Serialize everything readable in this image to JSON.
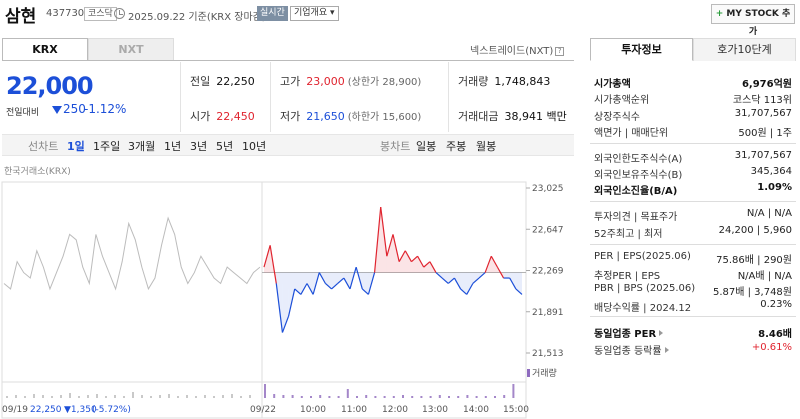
{
  "header": {
    "company_name": "삼현",
    "code": "437730",
    "market": "코스닥",
    "date_text": "2025.09.22 기준(KRX 장마감)",
    "realtime_label": "실시간",
    "overview_label": "기업개요 ▾",
    "mystock_label": "MY STOCK 추가",
    "mystock_plus": "+"
  },
  "tabs": {
    "krx": "KRX",
    "nxt": "NXT",
    "nxt_link": "넥스트레이드(NXT)",
    "help": "?"
  },
  "price": {
    "current": "22,000",
    "change_label": "전일대비",
    "change": "250",
    "change_pct": "-1.12%"
  },
  "stats": {
    "prev_label": "전일",
    "prev": "22,250",
    "high_label": "고가",
    "high": "23,000",
    "upper_limit": "(상한가 28,900)",
    "volume_label": "거래량",
    "volume": "1,748,843",
    "open_label": "시가",
    "open": "22,450",
    "low_label": "저가",
    "low": "21,650",
    "lower_limit": "(하한가 15,600)",
    "amount_label": "거래대금",
    "amount": "38,941 백만"
  },
  "period": {
    "line": "선차트",
    "d1": "1일",
    "w1": "1주일",
    "m3": "3개월",
    "y1": "1년",
    "y3": "3년",
    "y5": "5년",
    "y10": "10년",
    "candle": "봉차트",
    "daily": "일봉",
    "weekly": "주봉",
    "monthly": "월봉"
  },
  "chart_data": {
    "type": "line",
    "source_label": "한국거래소(KRX)",
    "volume_label": "거래량",
    "y_ticks": [
      "23,025",
      "22,647",
      "22,269",
      "21,891",
      "21,513"
    ],
    "ylim": [
      21513,
      23025
    ],
    "baseline": 22250,
    "x_ticks": [
      "09/22",
      "10:00",
      "11:00",
      "12:00",
      "13:00",
      "14:00",
      "15:00"
    ],
    "prev_day": {
      "label": "09/19",
      "close": "22,250",
      "change": "▼1,350",
      "pct": "(-5.72%)"
    },
    "previous_series": [
      22150,
      22100,
      22350,
      22250,
      22200,
      22450,
      22300,
      22100,
      22250,
      22400,
      22600,
      22550,
      22300,
      22150,
      22600,
      22400,
      22250,
      22100,
      22350,
      22700,
      22550,
      22300,
      22100,
      22200,
      22500,
      22750,
      22600,
      22300,
      22150,
      22250,
      22400,
      22300,
      22200,
      22150,
      22300,
      22250,
      22200,
      22150,
      22250,
      22300
    ],
    "today_series": [
      22300,
      22500,
      22150,
      21700,
      21850,
      22100,
      22050,
      22150,
      22050,
      22250,
      22150,
      22100,
      22150,
      22200,
      22100,
      22300,
      22100,
      22050,
      22250,
      22850,
      22400,
      22600,
      22350,
      22450,
      22350,
      22400,
      22300,
      22350,
      22250,
      22200,
      22150,
      22200,
      22100,
      22050,
      22150,
      22200,
      22250,
      22400,
      22300,
      22200,
      22200,
      22100,
      22050
    ]
  },
  "invest": {
    "tab_info": "투자정보",
    "tab_quote": "호가10단계",
    "rows": [
      {
        "k": "시가총액",
        "v": "6,976억원"
      },
      {
        "k": "시가총액순위",
        "v": "코스닥 113위"
      },
      {
        "k": "상장주식수",
        "v": "31,707,567"
      },
      {
        "k": "액면가 | 매매단위",
        "v": "500원 | 1주"
      },
      {
        "k": "외국인한도주식수(A)",
        "v": "31,707,567"
      },
      {
        "k": "외국인보유주식수(B)",
        "v": "345,364"
      },
      {
        "k": "외국인소진율(B/A)",
        "v": "1.09%"
      },
      {
        "k": "투자의견 | 목표주가",
        "v": "N/A | N/A"
      },
      {
        "k": "52주최고 | 최저",
        "v": "24,200 | 5,960"
      },
      {
        "k": "PER | EPS(2025.06)",
        "v": "75.86배 | 290원"
      },
      {
        "k": "추정PER | EPS",
        "v": "N/A배 | N/A"
      },
      {
        "k": "PBR | BPS (2025.06)",
        "v": "5.87배 | 3,748원"
      },
      {
        "k": "배당수익률 | 2024.12",
        "v": "0.23%"
      },
      {
        "k": "동일업종 PER",
        "v": "8.46배"
      },
      {
        "k": "동일업종 등락률",
        "v": "+0.61%"
      }
    ]
  },
  "colors": {
    "red": "#e0242f",
    "blue": "#1c4fd8",
    "gray_line": "#bcbcbc"
  }
}
